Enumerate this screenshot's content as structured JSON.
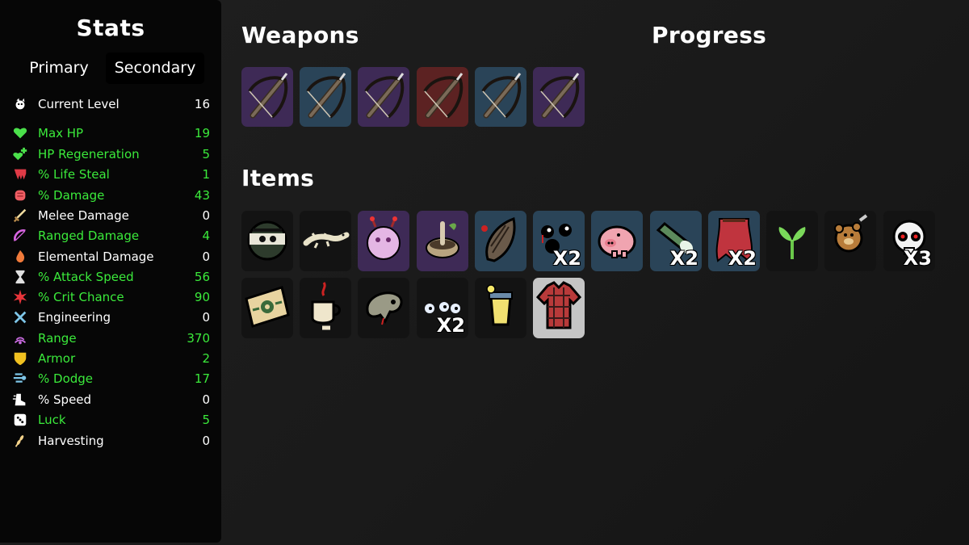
{
  "colors": {
    "stat_green": "#3bea3b",
    "stat_white": "#ffffff",
    "rarity_common": "#131313",
    "rarity_uncommon": "#2a4458",
    "rarity_rare": "#3e2a56",
    "rarity_legendary": "#5c2222",
    "rarity_selected": "#c5c5c5"
  },
  "stats": {
    "title": "Stats",
    "tabs": {
      "primary": "Primary",
      "secondary": "Secondary"
    },
    "rows": [
      {
        "label": "Current Level",
        "value": "16",
        "icon": "level-icon",
        "color": "white"
      },
      {
        "label": "Max HP",
        "value": "19",
        "icon": "heart-icon",
        "color": "green"
      },
      {
        "label": "HP Regeneration",
        "value": "5",
        "icon": "regen-icon",
        "color": "green"
      },
      {
        "label": "% Life Steal",
        "value": "1",
        "icon": "fang-icon",
        "color": "green"
      },
      {
        "label": "% Damage",
        "value": "43",
        "icon": "fist-icon",
        "color": "green"
      },
      {
        "label": "Melee Damage",
        "value": "0",
        "icon": "sword-icon",
        "color": "white"
      },
      {
        "label": "Ranged Damage",
        "value": "4",
        "icon": "bow-icon",
        "color": "green"
      },
      {
        "label": "Elemental Damage",
        "value": "0",
        "icon": "flame-icon",
        "color": "white"
      },
      {
        "label": "% Attack Speed",
        "value": "56",
        "icon": "hourglass-icon",
        "color": "green"
      },
      {
        "label": "% Crit Chance",
        "value": "90",
        "icon": "crit-icon",
        "color": "green"
      },
      {
        "label": "Engineering",
        "value": "0",
        "icon": "wrench-icon",
        "color": "white"
      },
      {
        "label": "Range",
        "value": "370",
        "icon": "range-icon",
        "color": "green"
      },
      {
        "label": "Armor",
        "value": "2",
        "icon": "shield-icon",
        "color": "green"
      },
      {
        "label": "% Dodge",
        "value": "17",
        "icon": "dodge-icon",
        "color": "green"
      },
      {
        "label": "% Speed",
        "value": "0",
        "icon": "boot-icon",
        "color": "white"
      },
      {
        "label": "Luck",
        "value": "5",
        "icon": "dice-icon",
        "color": "green"
      },
      {
        "label": "Harvesting",
        "value": "0",
        "icon": "wheat-icon",
        "color": "white"
      }
    ]
  },
  "weapons": {
    "title": "Weapons",
    "slots": [
      {
        "icon": "crossbow-icon",
        "rarity": "rare"
      },
      {
        "icon": "crossbow-icon",
        "rarity": "uncommon"
      },
      {
        "icon": "crossbow-icon",
        "rarity": "rare"
      },
      {
        "icon": "crossbow-icon",
        "rarity": "legendary"
      },
      {
        "icon": "crossbow-icon",
        "rarity": "uncommon"
      },
      {
        "icon": "crossbow-icon",
        "rarity": "rare"
      }
    ]
  },
  "progress": {
    "title": "Progress"
  },
  "items": {
    "title": "Items",
    "slots": [
      {
        "icon": "ninja-mask-icon",
        "rarity": "common",
        "count": ""
      },
      {
        "icon": "lizard-icon",
        "rarity": "common",
        "count": ""
      },
      {
        "icon": "pink-creature-icon",
        "rarity": "rare",
        "count": ""
      },
      {
        "icon": "mortar-pestle-icon",
        "rarity": "rare",
        "count": ""
      },
      {
        "icon": "claw-icon",
        "rarity": "uncommon",
        "count": ""
      },
      {
        "icon": "black-eyes-icon",
        "rarity": "uncommon",
        "count": "X2"
      },
      {
        "icon": "piggy-bank-icon",
        "rarity": "uncommon",
        "count": ""
      },
      {
        "icon": "flashlight-icon",
        "rarity": "uncommon",
        "count": "X2"
      },
      {
        "icon": "red-cape-icon",
        "rarity": "uncommon",
        "count": "X2"
      },
      {
        "icon": "sprout-icon",
        "rarity": "common",
        "count": ""
      },
      {
        "icon": "teddy-bear-icon",
        "rarity": "common",
        "count": ""
      },
      {
        "icon": "skull-icon",
        "rarity": "common",
        "count": "X3"
      },
      {
        "icon": "coupon-icon",
        "rarity": "common",
        "count": ""
      },
      {
        "icon": "coffee-cup-icon",
        "rarity": "common",
        "count": ""
      },
      {
        "icon": "grey-blob-icon",
        "rarity": "common",
        "count": ""
      },
      {
        "icon": "white-eyes-icon",
        "rarity": "common",
        "count": "X2"
      },
      {
        "icon": "lemonade-icon",
        "rarity": "common",
        "count": ""
      },
      {
        "icon": "plaid-shirt-icon",
        "rarity": "selected",
        "count": ""
      }
    ]
  }
}
